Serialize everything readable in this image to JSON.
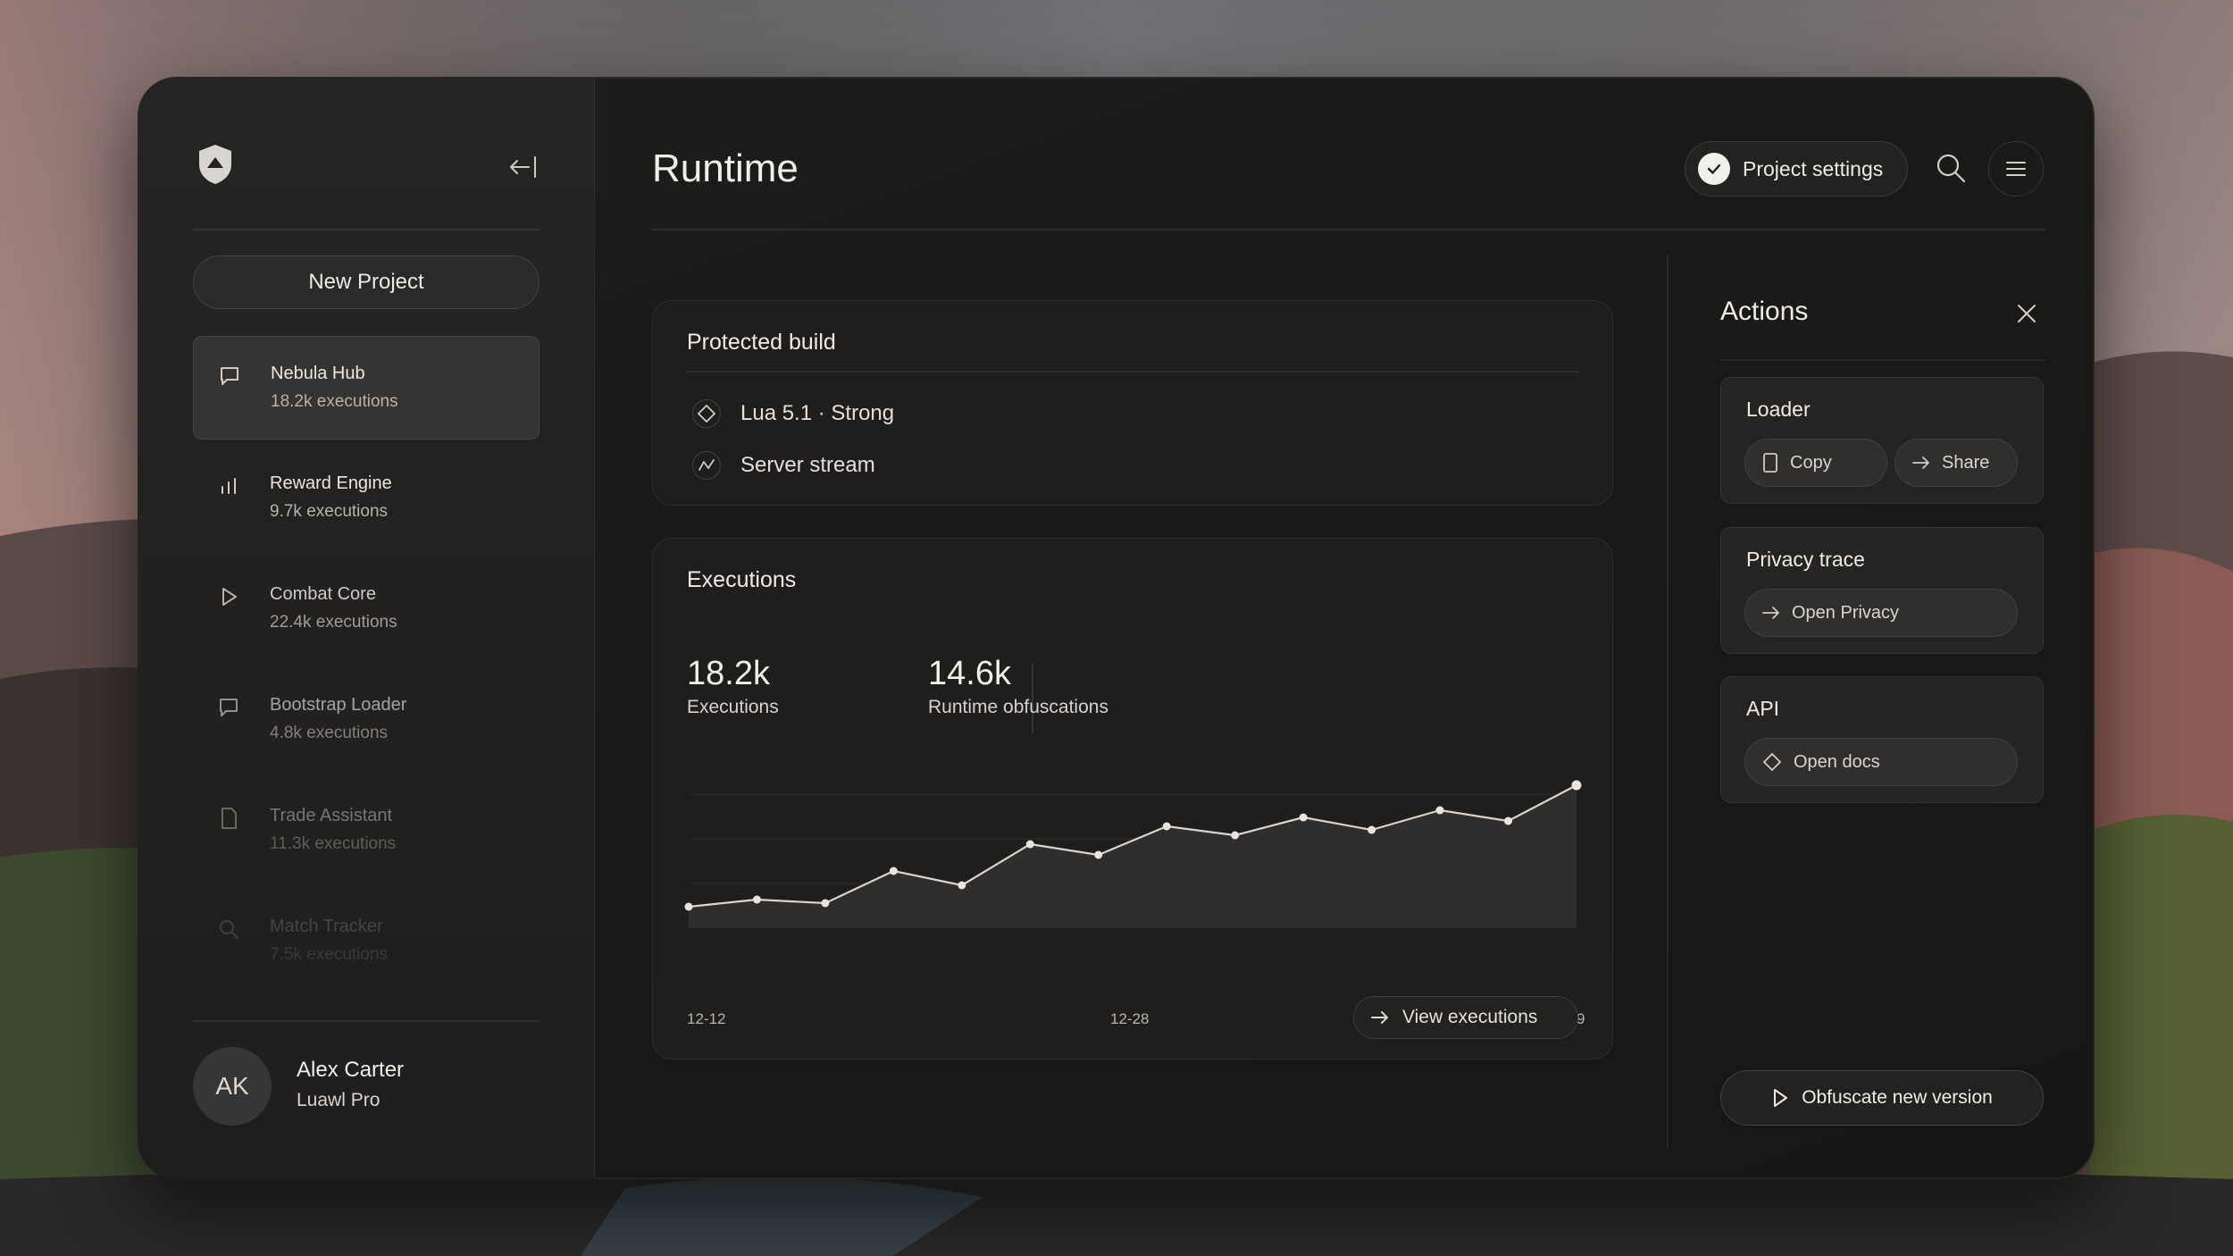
{
  "sidebar": {
    "new_project_label": "New Project",
    "items": [
      {
        "name": "Nebula Hub",
        "meta": "18.2k executions",
        "icon": "chat-icon",
        "opacity": 1.0
      },
      {
        "name": "Reward Engine",
        "meta": "9.7k executions",
        "icon": "bar-chart-icon",
        "opacity": 1.0
      },
      {
        "name": "Combat Core",
        "meta": "22.4k executions",
        "icon": "play-icon",
        "opacity": 0.85
      },
      {
        "name": "Bootstrap Loader",
        "meta": "4.8k executions",
        "icon": "chat-icon",
        "opacity": 0.65
      },
      {
        "name": "Trade Assistant",
        "meta": "11.3k executions",
        "icon": "document-icon",
        "opacity": 0.42
      },
      {
        "name": "Match Tracker",
        "meta": "7.5k executions",
        "icon": "search-icon",
        "opacity": 0.18
      }
    ],
    "user": {
      "initials": "AK",
      "name": "Alex Carter",
      "plan": "Luawl Pro"
    }
  },
  "header": {
    "title": "Runtime",
    "settings_label": "Project settings"
  },
  "build": {
    "title": "Protected build",
    "rows": [
      {
        "icon": "code-icon",
        "text": "Lua 5.1 · Strong"
      },
      {
        "icon": "stream-icon",
        "text": "Server stream"
      }
    ]
  },
  "executions": {
    "title": "Executions",
    "stats": [
      {
        "value": "18.2k",
        "label": "Executions"
      },
      {
        "value": "14.6k",
        "label": "Runtime obfuscations"
      }
    ],
    "view_label": "View executions"
  },
  "chart_data": {
    "type": "area",
    "x_tick_labels": [
      "12-12",
      "12-28",
      "01-09"
    ],
    "values": [
      12,
      16,
      14,
      32,
      24,
      47,
      41,
      57,
      52,
      62,
      55,
      66,
      60,
      80
    ],
    "ylim": [
      0,
      100
    ],
    "grid": true,
    "colors": {
      "line": "#d8d5d0",
      "fill": "#2f2e2d"
    }
  },
  "actions": {
    "title": "Actions",
    "cards": [
      {
        "title": "Loader",
        "buttons": [
          {
            "label": "Copy",
            "icon": "copy-icon"
          },
          {
            "label": "Share",
            "icon": "arrow-right-icon"
          }
        ]
      },
      {
        "title": "Privacy trace",
        "buttons": [
          {
            "label": "Open Privacy",
            "icon": "arrow-right-icon"
          }
        ]
      },
      {
        "title": "API",
        "buttons": [
          {
            "label": "Open docs",
            "icon": "code-icon"
          }
        ]
      }
    ],
    "primary_label": "Obfuscate new version"
  }
}
